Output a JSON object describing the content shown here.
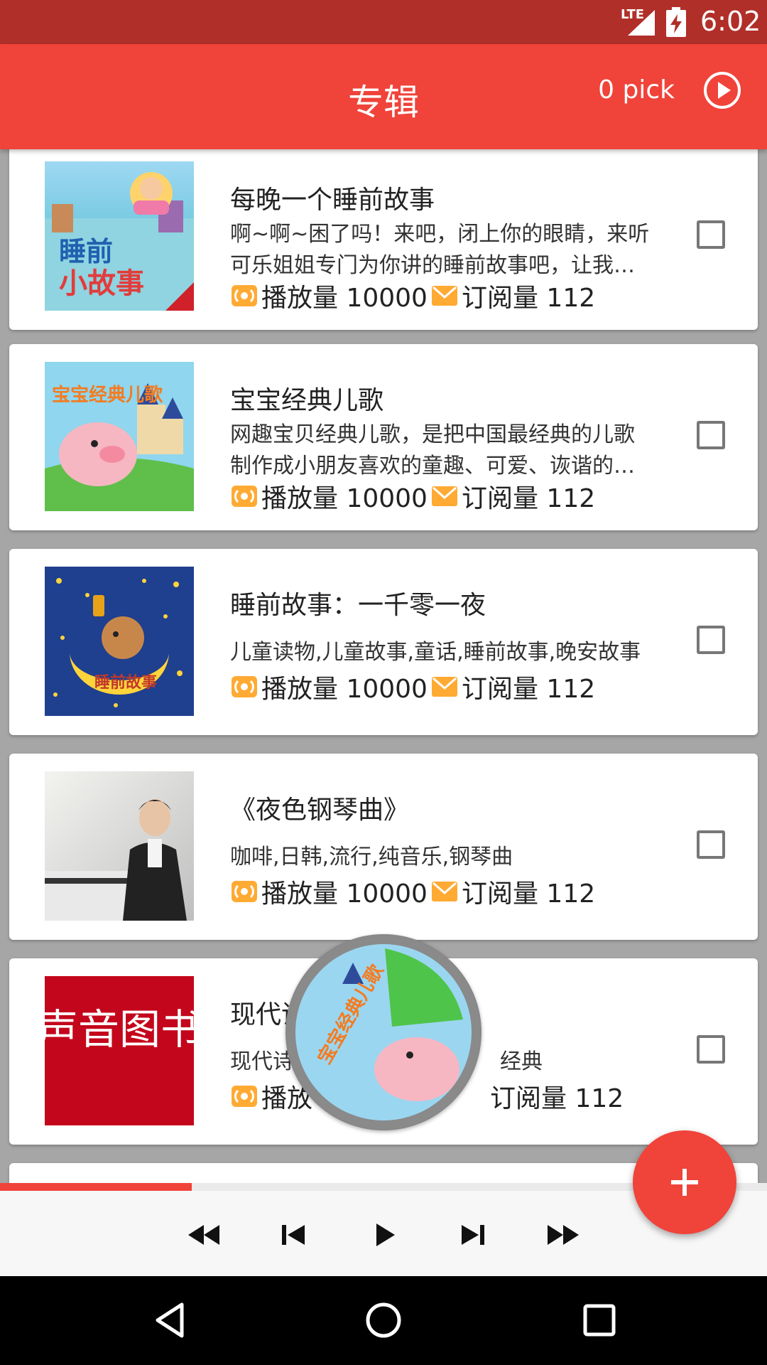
{
  "status_bar": {
    "network": "LTE",
    "time": "6:02"
  },
  "app_bar": {
    "title": "专辑",
    "pick_label": "0 pick"
  },
  "albums": [
    {
      "title": "每晚一个睡前故事",
      "desc_line1": "啊~啊~困了吗！来吧，闭上你的眼睛，来听",
      "desc_line2": "可乐姐姐专门为你讲的睡前故事吧，让我…",
      "plays": "播放量 10000",
      "subs": "订阅量 112",
      "cover": "sleep-story-cover"
    },
    {
      "title": "宝宝经典儿歌",
      "desc_line1": "网趣宝贝经典儿歌，是把中国最经典的儿歌",
      "desc_line2": "制作成小朋友喜欢的童趣、可爱、诙谐的…",
      "plays": "播放量 10000",
      "subs": "订阅量 112",
      "cover": "baby-songs-cover"
    },
    {
      "title": "睡前故事：一千零一夜",
      "desc_line1": "儿童读物,儿童故事,童话,睡前故事,晚安故事",
      "plays": "播放量 10000",
      "subs": "订阅量 112",
      "cover": "moon-bear-cover"
    },
    {
      "title": "《夜色钢琴曲》",
      "desc_line1": "咖啡,日韩,流行,纯音乐,钢琴曲",
      "plays": "播放量 10000",
      "subs": "订阅量 112",
      "cover": "piano-cover"
    },
    {
      "title": "现代诗",
      "desc_line1": "现代诗",
      "desc_line1_tail": "经典",
      "plays": "播放",
      "subs": "订阅量 112",
      "cover": "poetry-cover",
      "cover_text": "声音图书"
    }
  ],
  "player": {
    "progress_fraction": 0.25
  },
  "colors": {
    "primary": "#f0433a",
    "primary_dark": "#b12f29",
    "accent_icon": "#ffaa33"
  },
  "icons": {
    "plays": "broadcast-icon",
    "subs": "envelope-icon",
    "controls": [
      "rewind-icon",
      "skip-previous-icon",
      "play-icon",
      "skip-next-icon",
      "fast-forward-icon"
    ]
  }
}
